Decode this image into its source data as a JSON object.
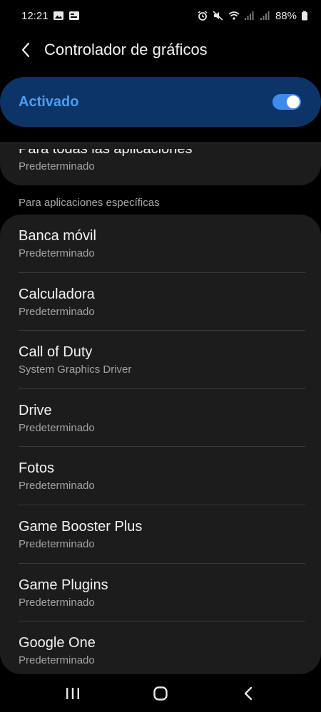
{
  "status_bar": {
    "time": "12:21",
    "battery": "88%",
    "left_icons": [
      "image-icon",
      "notification-icon"
    ],
    "right_icons": [
      "alarm-icon",
      "mute-icon",
      "wifi-icon",
      "signal-icon",
      "signal-icon",
      "battery-icon"
    ]
  },
  "header": {
    "back_icon": "chevron-left-icon",
    "title": "Controlador de gráficos"
  },
  "toggle": {
    "label": "Activado",
    "state": "on"
  },
  "all_apps": {
    "title": "Para todas las aplicaciones",
    "value": "Predeterminado"
  },
  "section_label": "Para aplicaciones específicas",
  "apps": [
    {
      "name": "Banca móvil",
      "value": "Predeterminado"
    },
    {
      "name": "Calculadora",
      "value": "Predeterminado"
    },
    {
      "name": "Call of Duty",
      "value": "System Graphics Driver"
    },
    {
      "name": "Drive",
      "value": "Predeterminado"
    },
    {
      "name": "Fotos",
      "value": "Predeterminado"
    },
    {
      "name": "Game Booster Plus",
      "value": "Predeterminado"
    },
    {
      "name": "Game Plugins",
      "value": "Predeterminado"
    },
    {
      "name": "Google One",
      "value": "Predeterminado"
    }
  ],
  "nav": {
    "recents_icon": "recents-icon",
    "home_icon": "home-icon",
    "back_icon": "back-icon"
  },
  "colors": {
    "background": "#000000",
    "card": "#1c1c1c",
    "toggle_card": "#0c3466",
    "accent": "#4d9cf5",
    "secondary_text": "#a3a3a3"
  }
}
